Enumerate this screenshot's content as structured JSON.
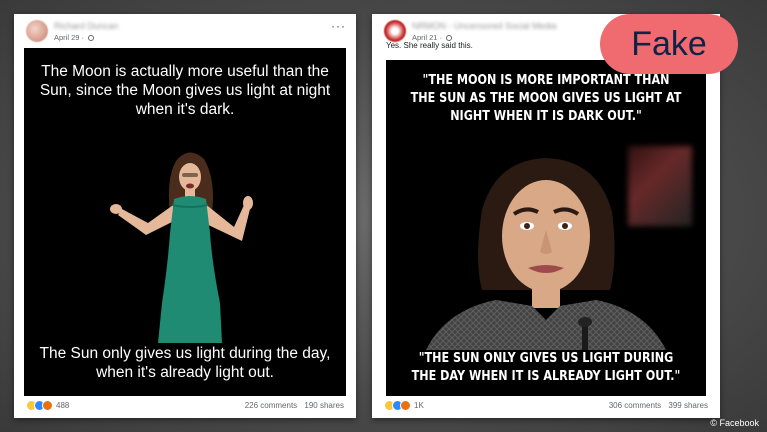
{
  "left_post": {
    "author": "Richard Duncan",
    "date": "April 29",
    "meme_top": "The Moon is actually more useful than the Sun, since the Moon gives us light at night when it's dark.",
    "meme_bottom": "The Sun only gives us light during the day, when it's already light out.",
    "reactions_count": "488",
    "comments": "226 comments",
    "shares": "190 shares"
  },
  "right_post": {
    "author": "NRMON - Uncensored Social Media",
    "date": "April 21",
    "caption": "Yes. She really said this.",
    "meme_top": "\"THE MOON IS MORE IMPORTANT THAN THE SUN AS THE MOON GIVES US LIGHT AT NIGHT WHEN IT IS DARK OUT.\"",
    "meme_bottom": "\"THE SUN ONLY GIVES US LIGHT DURING THE DAY WHEN IT IS ALREADY LIGHT OUT.\"",
    "reactions_count": "1K",
    "comments": "306 comments",
    "shares": "399 shares"
  },
  "badge": {
    "label": "Fake",
    "color": "#f06b6f"
  },
  "credit": "© Facebook",
  "icons": [
    "globe-icon",
    "more-icon",
    "haha-reaction-icon",
    "like-reaction-icon",
    "angry-reaction-icon"
  ]
}
